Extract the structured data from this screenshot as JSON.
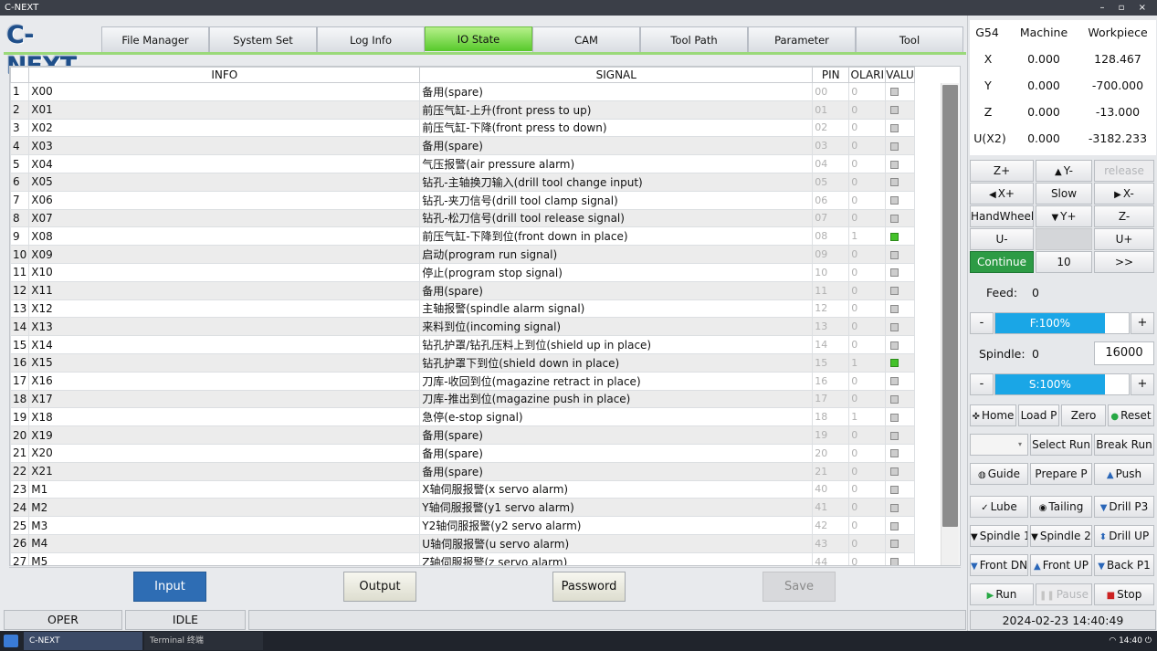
{
  "window": {
    "title": "C-NEXT",
    "controls": "– ▫ ×"
  },
  "app": {
    "logo": "C-NEXT"
  },
  "tabs": [
    "File Manager",
    "System Set",
    "Log Info",
    "IO State",
    "CAM",
    "Tool Path",
    "Parameter",
    "Tool"
  ],
  "active_tab": "IO State",
  "table": {
    "headers": {
      "info": "INFO",
      "signal": "SIGNAL",
      "pin": "PIN",
      "polarity": "OLARI",
      "value": "VALU"
    },
    "rows": [
      {
        "n": "1",
        "info": "X00",
        "signal": "备用(spare)",
        "pin": "00",
        "pol": "0",
        "val": 0
      },
      {
        "n": "2",
        "info": "X01",
        "signal": "前压气缸-上升(front press to up)",
        "pin": "01",
        "pol": "0",
        "val": 0
      },
      {
        "n": "3",
        "info": "X02",
        "signal": "前压气缸-下降(front press to down)",
        "pin": "02",
        "pol": "0",
        "val": 0
      },
      {
        "n": "4",
        "info": "X03",
        "signal": "备用(spare)",
        "pin": "03",
        "pol": "0",
        "val": 0
      },
      {
        "n": "5",
        "info": "X04",
        "signal": "气压报警(air pressure alarm)",
        "pin": "04",
        "pol": "0",
        "val": 0
      },
      {
        "n": "6",
        "info": "X05",
        "signal": "钻孔-主轴换刀输入(drill tool change input)",
        "pin": "05",
        "pol": "0",
        "val": 0
      },
      {
        "n": "7",
        "info": "X06",
        "signal": "钻孔-夹刀信号(drill tool clamp signal)",
        "pin": "06",
        "pol": "0",
        "val": 0
      },
      {
        "n": "8",
        "info": "X07",
        "signal": "钻孔-松刀信号(drill tool release signal)",
        "pin": "07",
        "pol": "0",
        "val": 0
      },
      {
        "n": "9",
        "info": "X08",
        "signal": "前压气缸-下降到位(front down in place)",
        "pin": "08",
        "pol": "1",
        "val": 1
      },
      {
        "n": "10",
        "info": "X09",
        "signal": "启动(program run signal)",
        "pin": "09",
        "pol": "0",
        "val": 0
      },
      {
        "n": "11",
        "info": "X10",
        "signal": "停止(program stop signal)",
        "pin": "10",
        "pol": "0",
        "val": 0
      },
      {
        "n": "12",
        "info": "X11",
        "signal": "备用(spare)",
        "pin": "11",
        "pol": "0",
        "val": 0
      },
      {
        "n": "13",
        "info": "X12",
        "signal": "主轴报警(spindle alarm signal)",
        "pin": "12",
        "pol": "0",
        "val": 0
      },
      {
        "n": "14",
        "info": "X13",
        "signal": "来料到位(incoming signal)",
        "pin": "13",
        "pol": "0",
        "val": 0
      },
      {
        "n": "15",
        "info": "X14",
        "signal": "钻孔护罩/钻孔压料上到位(shield up in place)",
        "pin": "14",
        "pol": "0",
        "val": 0
      },
      {
        "n": "16",
        "info": "X15",
        "signal": "钻孔护罩下到位(shield down in place)",
        "pin": "15",
        "pol": "1",
        "val": 1
      },
      {
        "n": "17",
        "info": "X16",
        "signal": "刀库-收回到位(magazine retract in place)",
        "pin": "16",
        "pol": "0",
        "val": 0
      },
      {
        "n": "18",
        "info": "X17",
        "signal": "刀库-推出到位(magazine push in place)",
        "pin": "17",
        "pol": "0",
        "val": 0
      },
      {
        "n": "19",
        "info": "X18",
        "signal": "急停(e-stop signal)",
        "pin": "18",
        "pol": "1",
        "val": 0
      },
      {
        "n": "20",
        "info": "X19",
        "signal": "备用(spare)",
        "pin": "19",
        "pol": "0",
        "val": 0
      },
      {
        "n": "21",
        "info": "X20",
        "signal": "备用(spare)",
        "pin": "20",
        "pol": "0",
        "val": 0
      },
      {
        "n": "22",
        "info": "X21",
        "signal": "备用(spare)",
        "pin": "21",
        "pol": "0",
        "val": 0
      },
      {
        "n": "23",
        "info": "M1",
        "signal": "X轴伺服报警(x servo alarm)",
        "pin": "40",
        "pol": "0",
        "val": 0
      },
      {
        "n": "24",
        "info": "M2",
        "signal": "Y轴伺服报警(y1 servo alarm)",
        "pin": "41",
        "pol": "0",
        "val": 0
      },
      {
        "n": "25",
        "info": "M3",
        "signal": "Y2轴伺服报警(y2 servo alarm)",
        "pin": "42",
        "pol": "0",
        "val": 0
      },
      {
        "n": "26",
        "info": "M4",
        "signal": "U轴伺服报警(u servo alarm)",
        "pin": "43",
        "pol": "0",
        "val": 0
      },
      {
        "n": "27",
        "info": "M5",
        "signal": "Z轴伺服报警(z servo alarm)",
        "pin": "44",
        "pol": "0",
        "val": 0
      }
    ]
  },
  "bottom_buttons": {
    "input": "Input",
    "output": "Output",
    "password": "Password",
    "save": "Save"
  },
  "status": {
    "mode": "OPER",
    "state": "IDLE",
    "message": ""
  },
  "coords": {
    "header": {
      "wcs": "G54",
      "machine": "Machine",
      "workpiece": "Workpiece"
    },
    "rows": [
      {
        "axis": "X",
        "machine": "0.000",
        "work": "128.467"
      },
      {
        "axis": "Y",
        "machine": "0.000",
        "work": "-700.000"
      },
      {
        "axis": "Z",
        "machine": "0.000",
        "work": "-13.000"
      },
      {
        "axis": "U(X2)",
        "machine": "0.000",
        "work": "-3182.233"
      }
    ]
  },
  "jog": {
    "z_plus": "Z+",
    "y_minus": "Y-",
    "release": "release",
    "x_plus": "X+",
    "slow": "Slow",
    "x_minus": "X-",
    "handwheel": "HandWheel",
    "y_plus": "Y+",
    "z_minus": "Z-",
    "u_minus": "U-",
    "u_plus": "U+",
    "continue": "Continue",
    "step": "10",
    "more": ">>"
  },
  "feed": {
    "label": "Feed:",
    "value": "0",
    "minus": "-",
    "override": "F:100%",
    "override_pct": 100,
    "plus": "+"
  },
  "spindle": {
    "label": "Spindle:",
    "value": "0",
    "speed_input": "16000",
    "minus": "-",
    "override": "S:100%",
    "override_pct": 100,
    "plus": "+"
  },
  "ops": {
    "home": "Home",
    "load_p": "Load P",
    "zero": "Zero",
    "reset": "Reset",
    "select_run": "Select Run",
    "break_run": "Break Run",
    "guide": "Guide",
    "prepare_p": "Prepare P",
    "push": "Push",
    "lube": "Lube",
    "tailing": "Tailing",
    "drill_p3": "Drill P3",
    "spindle1": "Spindle 1",
    "spindle2": "Spindle 2",
    "drill_up": "Drill UP",
    "front_dn": "Front DN",
    "front_up": "Front UP",
    "back_p1": "Back P1",
    "run": "Run",
    "pause": "Pause",
    "stop": "Stop"
  },
  "datetime": "2024-02-23 14:40:49",
  "taskbar": {
    "app1": "C-NEXT",
    "app2": "Terminal 终端",
    "time": "14:40"
  },
  "colors": {
    "accent": "#2e6db4",
    "active_tab": "#56c92a",
    "led_on": "#44c22a",
    "override_bar": "#1aa6e6",
    "continue": "#2d9b45"
  }
}
